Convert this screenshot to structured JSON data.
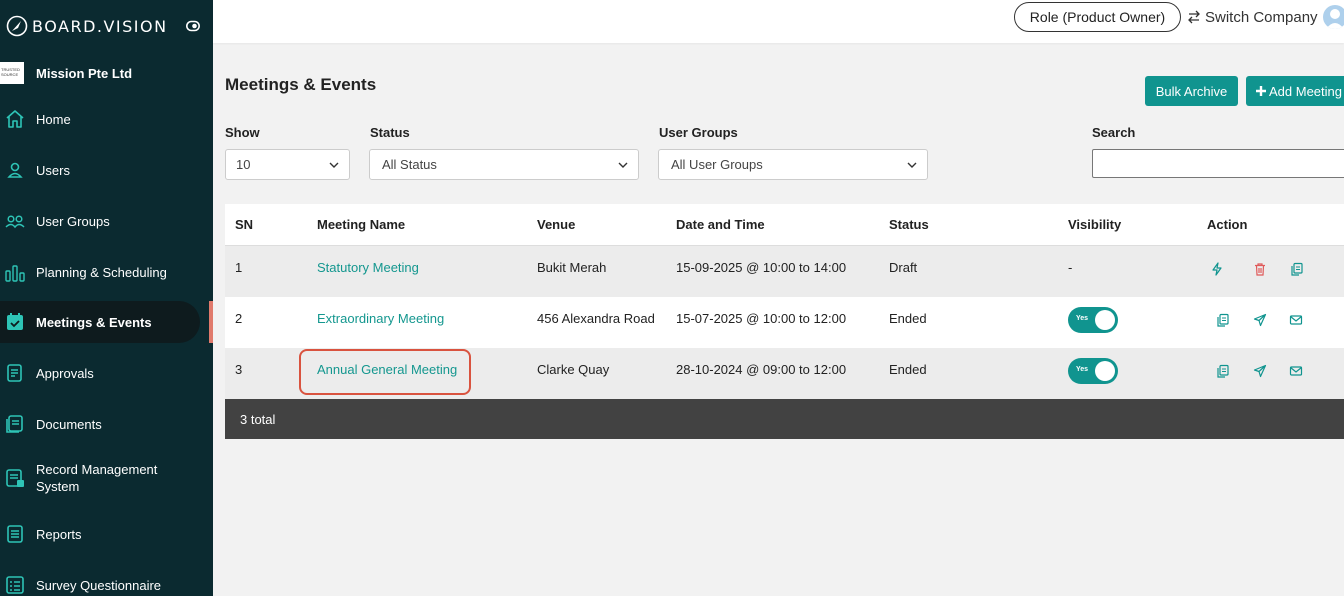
{
  "sidebar": {
    "brand": "BOARD.VISION",
    "company_name": "Mission Pte Ltd",
    "company_logo_text": "TRUSTED SOURCE",
    "items": [
      {
        "label": "Home",
        "icon": "home-icon"
      },
      {
        "label": "Users",
        "icon": "user-icon"
      },
      {
        "label": "User Groups",
        "icon": "user-groups-icon"
      },
      {
        "label": "Planning & Scheduling",
        "icon": "bar-chart-icon"
      },
      {
        "label": "Meetings & Events",
        "icon": "calendar-check-icon",
        "active": true
      },
      {
        "label": "Approvals",
        "icon": "document-icon"
      },
      {
        "label": "Documents",
        "icon": "documents-icon"
      },
      {
        "label": "Record Management System",
        "icon": "record-icon"
      },
      {
        "label": "Reports",
        "icon": "report-icon"
      },
      {
        "label": "Survey Questionnaire",
        "icon": "survey-icon"
      }
    ]
  },
  "topbar": {
    "role": "Role (Product Owner)",
    "switch_company": "Switch Company"
  },
  "main": {
    "title": "Meetings & Events",
    "bulk_archive": "Bulk Archive",
    "add_meeting": "Add Meeting",
    "filters": {
      "show_label": "Show",
      "show_value": "10",
      "status_label": "Status",
      "status_value": "All Status",
      "groups_label": "User Groups",
      "groups_value": "All User Groups",
      "search_label": "Search",
      "search_value": ""
    },
    "table": {
      "headers": [
        "SN",
        "Meeting Name",
        "Venue",
        "Date and Time",
        "Status",
        "Visibility",
        "Action"
      ],
      "rows": [
        {
          "sn": "1",
          "name": "Statutory Meeting",
          "venue": "Bukit Merah",
          "datetime": "15-09-2025 @ 10:00 to 14:00",
          "status": "Draft",
          "visibility": "-"
        },
        {
          "sn": "2",
          "name": "Extraordinary Meeting",
          "venue": "456 Alexandra Road",
          "datetime": "15-07-2025 @ 10:00 to 12:00",
          "status": "Ended",
          "visibility": "Yes"
        },
        {
          "sn": "3",
          "name": "Annual General Meeting",
          "venue": "Clarke Quay",
          "datetime": "28-10-2024 @ 09:00 to 12:00",
          "status": "Ended",
          "visibility": "Yes"
        }
      ],
      "footer": "3 total"
    }
  },
  "colors": {
    "sidebar_bg": "#0b2a30",
    "accent": "#10948f",
    "highlight": "#d9533f",
    "delete": "#e05a5a"
  }
}
